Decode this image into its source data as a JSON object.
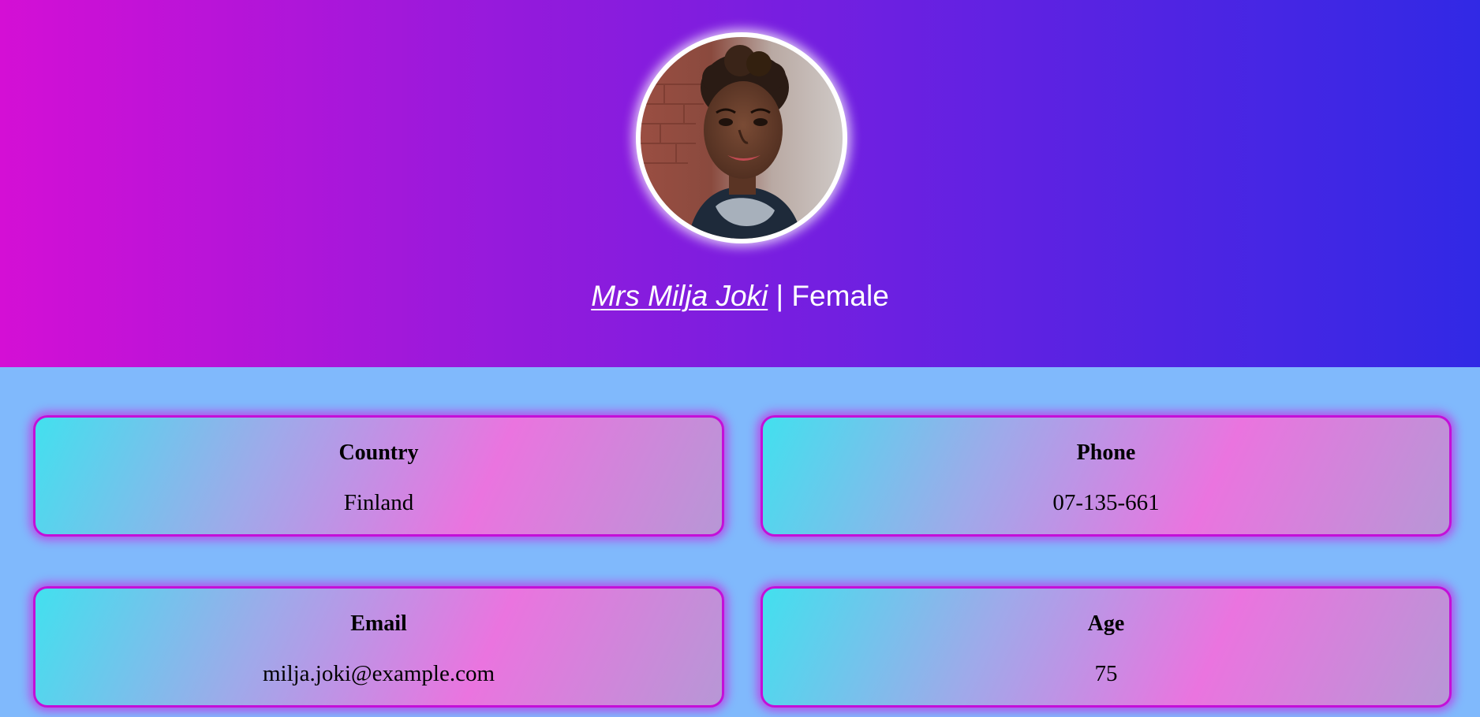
{
  "profile": {
    "title": "Mrs",
    "first_name": "Milja",
    "last_name": "Joki",
    "full_name": "Mrs Milja Joki",
    "separator": " | ",
    "gender": "Female",
    "avatar_icon": "profile-photo"
  },
  "details": [
    {
      "label": "Country",
      "value": "Finland"
    },
    {
      "label": "Phone",
      "value": "07-135-661"
    },
    {
      "label": "Email",
      "value": "milja.joki@example.com"
    },
    {
      "label": "Age",
      "value": "75"
    }
  ],
  "colors": {
    "background": "#80b9fc",
    "header_gradient": [
      "#d40fd5",
      "#9c19db",
      "#6c20e1",
      "#3129e5"
    ],
    "card_gradient": [
      "#42e0ee",
      "#9eaaea",
      "#ea74df",
      "#b797d6"
    ],
    "card_border": "#c40fd8"
  }
}
